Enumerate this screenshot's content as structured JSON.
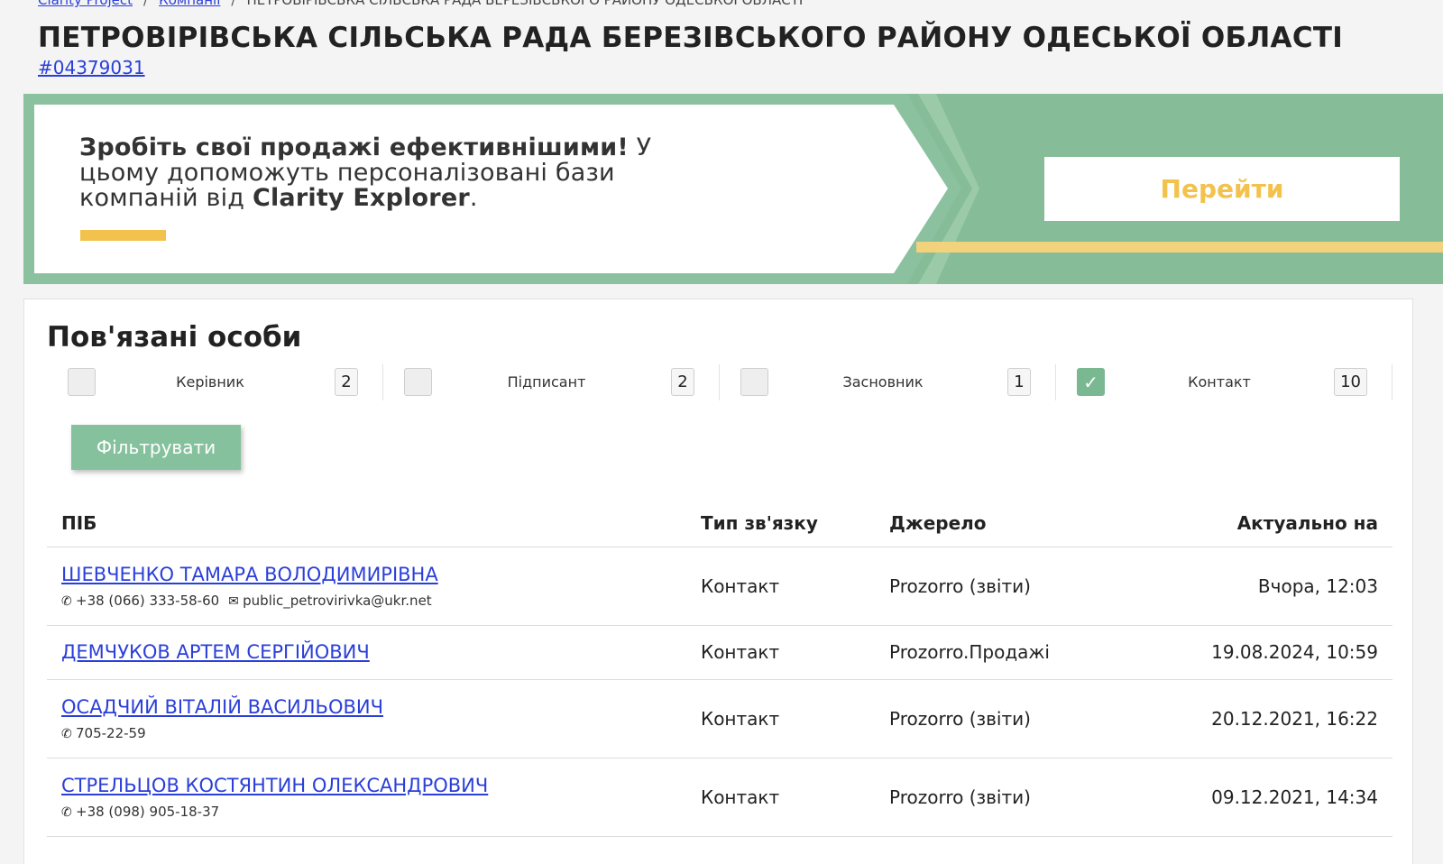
{
  "breadcrumb": {
    "items": [
      "Clarity Project",
      "Компанії"
    ],
    "current": "ПЕТРОВІРІВСЬКА СІЛЬСЬКА РАДА БЕРЕЗІВСЬКОГО РАЙОНУ ОДЕСЬКОЇ ОБЛАСТІ",
    "separator": "/"
  },
  "company": {
    "title": "ПЕТРОВІРІВСЬКА СІЛЬСЬКА РАДА БЕРЕЗІВСЬКОГО РАЙОНУ ОДЕСЬКОЇ ОБЛАСТІ",
    "code": "#04379031"
  },
  "banner": {
    "headline": "Зробіть свої продажі ефективнішими!",
    "text": " У цьому допоможуть персоналізовані бази компаній від ",
    "brand": "Clarity Explorer",
    "end": ".",
    "button": "Перейти",
    "colors": {
      "green": "#8bc19f",
      "yellow": "#f2c24d"
    }
  },
  "related": {
    "title": "Пов'язані особи",
    "filters": [
      {
        "label": "Керівник",
        "count": "2",
        "checked": false
      },
      {
        "label": "Підписант",
        "count": "2",
        "checked": false
      },
      {
        "label": "Засновник",
        "count": "1",
        "checked": false
      },
      {
        "label": "Контакт",
        "count": "10",
        "checked": true
      }
    ],
    "filter_button": "Фільтрувати",
    "check_mark": "✓",
    "columns": {
      "name": "ПІБ",
      "type": "Тип зв'язку",
      "source": "Джерело",
      "date": "Актуально на"
    },
    "rows": [
      {
        "name": "ШЕВЧЕНКО ТАМАРА ВОЛОДИМИРІВНА",
        "phone": "+38 (066) 333-58-60",
        "email": "public_petrovirivka@ukr.net",
        "type": "Контакт",
        "source": "Prozorro (звіти)",
        "date": "Вчора, 12:03"
      },
      {
        "name": "ДЕМЧУКОВ АРТЕМ СЕРГІЙОВИЧ",
        "phone": "",
        "email": "",
        "type": "Контакт",
        "source": "Prozorro.Продажі",
        "date": "19.08.2024, 10:59"
      },
      {
        "name": "ОСАДЧИЙ ВІТАЛІЙ ВАСИЛЬОВИЧ",
        "phone": "705-22-59",
        "email": "",
        "type": "Контакт",
        "source": "Prozorro (звіти)",
        "date": "20.12.2021, 16:22"
      },
      {
        "name": "СТРЕЛЬЦОВ КОСТЯНТИН ОЛЕКСАНДРОВИЧ",
        "phone": "+38 (098) 905-18-37",
        "email": "",
        "type": "Контакт",
        "source": "Prozorro (звіти)",
        "date": "09.12.2021, 14:34"
      }
    ]
  },
  "icons": {
    "phone": "phone-icon",
    "email": "envelope-icon"
  }
}
